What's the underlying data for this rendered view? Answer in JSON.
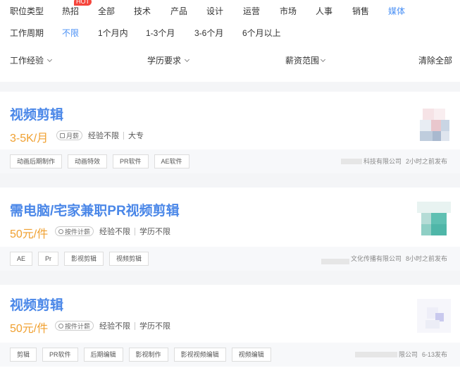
{
  "filters": {
    "row1": {
      "label": "职位类型",
      "hot_badge": "HOT",
      "options": [
        "热招",
        "全部",
        "技术",
        "产品",
        "设计",
        "运营",
        "市场",
        "人事",
        "销售",
        "媒体"
      ]
    },
    "row2": {
      "label": "工作周期",
      "options": [
        "不限",
        "1个月内",
        "1-3个月",
        "3-6个月",
        "6个月以上"
      ]
    },
    "row3": {
      "experience": "工作经验",
      "education": "学历要求",
      "salary": "薪资范围",
      "clear": "清除全部"
    }
  },
  "jobs": [
    {
      "title": "视频剪辑",
      "salary": "3-5K/月",
      "pay_tag": "月薪",
      "experience": "经验不限",
      "education": "大专",
      "tags": [
        "动画后期制作",
        "动画特效",
        "PR软件",
        "AE软件"
      ],
      "company": "科技有限公司",
      "posted": "2小时之前发布"
    },
    {
      "title": "需电脑/宅家兼职PR视频剪辑",
      "salary": "50元/件",
      "pay_tag": "按件计薪",
      "experience": "经验不限",
      "education": "学历不限",
      "tags": [
        "AE",
        "Pr",
        "影视剪辑",
        "视频剪辑"
      ],
      "company": "文化传播有限公司",
      "posted": "8小时之前发布"
    },
    {
      "title": "视频剪辑",
      "salary": "50元/件",
      "pay_tag": "按件计薪",
      "experience": "经验不限",
      "education": "学历不限",
      "tags": [
        "剪辑",
        "PR软件",
        "后期编辑",
        "影视制作",
        "影视视频编辑",
        "视频编辑"
      ],
      "company": "限公司",
      "posted": "6-13发布"
    }
  ],
  "colors": {
    "accent": "#4a87e8",
    "salary": "#f0a030",
    "hot": "#f5453c"
  }
}
